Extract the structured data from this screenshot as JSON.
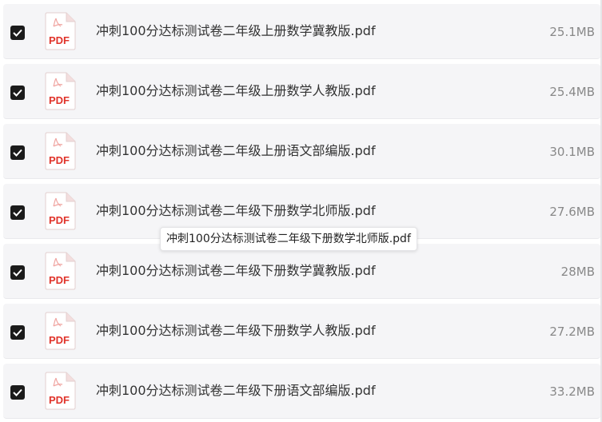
{
  "files": [
    {
      "name": "冲刺100分达标测试卷二年级上册数学冀教版.pdf",
      "size": "25.1MB",
      "checked": true,
      "icon_label": "PDF"
    },
    {
      "name": "冲刺100分达标测试卷二年级上册数学人教版.pdf",
      "size": "25.4MB",
      "checked": true,
      "icon_label": "PDF"
    },
    {
      "name": "冲刺100分达标测试卷二年级上册语文部编版.pdf",
      "size": "30.1MB",
      "checked": true,
      "icon_label": "PDF"
    },
    {
      "name": "冲刺100分达标测试卷二年级下册数学北师版.pdf",
      "size": "27.6MB",
      "checked": true,
      "icon_label": "PDF"
    },
    {
      "name": "冲刺100分达标测试卷二年级下册数学冀教版.pdf",
      "size": "28MB",
      "checked": true,
      "icon_label": "PDF"
    },
    {
      "name": "冲刺100分达标测试卷二年级下册数学人教版.pdf",
      "size": "27.2MB",
      "checked": true,
      "icon_label": "PDF"
    },
    {
      "name": "冲刺100分达标测试卷二年级下册语文部编版.pdf",
      "size": "33.2MB",
      "checked": true,
      "icon_label": "PDF"
    }
  ],
  "tooltip": {
    "text": "冲刺100分达标测试卷二年级下册数学北师版.pdf"
  },
  "colors": {
    "row_bg": "#f5f5f7",
    "checkbox": "#1b1b1b",
    "pdf_red": "#e0332a",
    "name_text": "#333333",
    "size_text": "#888888"
  }
}
